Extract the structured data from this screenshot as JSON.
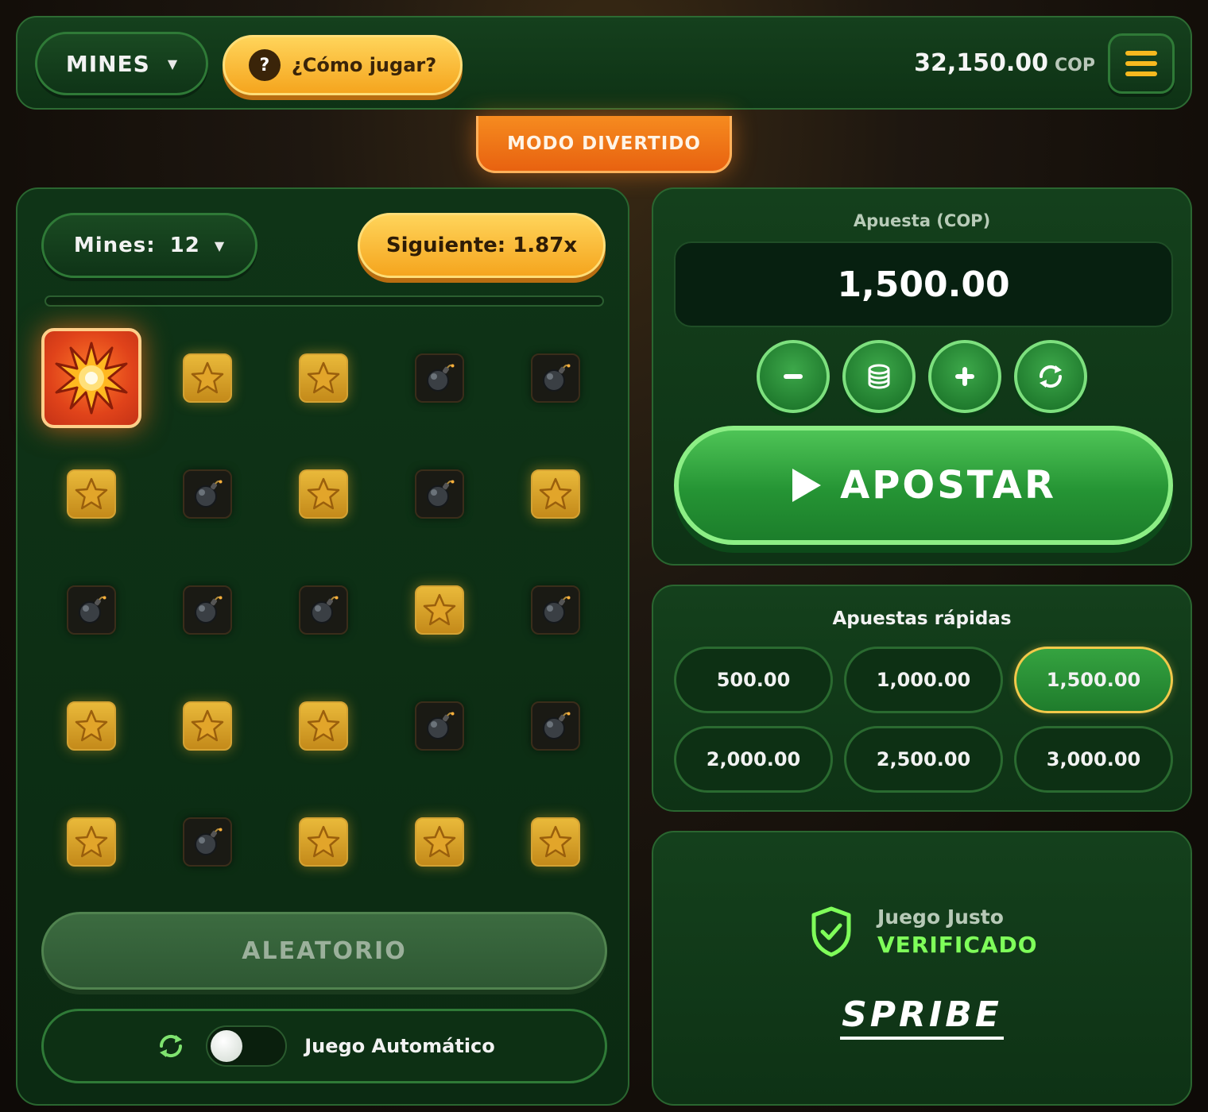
{
  "header": {
    "game_label": "MINES",
    "how_to_play": "¿Cómo jugar?",
    "balance_amount": "32,150.00",
    "balance_currency": "COP",
    "fun_mode": "MODO DIVERTIDO"
  },
  "board": {
    "mines_label": "Mines:",
    "mines_value": "12",
    "next_multiplier": "Siguiente: 1.87x",
    "progress": 0,
    "tiles": [
      "explosion",
      "star",
      "star",
      "bomb",
      "bomb",
      "star",
      "bomb",
      "star",
      "bomb",
      "star",
      "bomb",
      "bomb",
      "bomb",
      "star",
      "bomb",
      "star",
      "star",
      "star",
      "bomb",
      "bomb",
      "star",
      "bomb",
      "star",
      "star",
      "star"
    ],
    "random_label": "ALEATORIO",
    "auto_label": "Juego Automático",
    "auto_enabled": false
  },
  "bet": {
    "title": "Apuesta (COP)",
    "amount": "1,500.00",
    "tools": [
      "minus-icon",
      "coins-icon",
      "plus-icon",
      "refresh-icon"
    ],
    "play_label": "APOSTAR"
  },
  "quick": {
    "title": "Apuestas rápidas",
    "options": [
      "500.00",
      "1,000.00",
      "1,500.00",
      "2,000.00",
      "2,500.00",
      "3,000.00"
    ],
    "selected_index": 2
  },
  "fair": {
    "line1": "Juego Justo",
    "line2": "VERIFICADO",
    "brand": "SPRIBE"
  },
  "colors": {
    "accent_green": "#7fff5a",
    "gold": "#f7b91f",
    "orange": "#e86210"
  }
}
